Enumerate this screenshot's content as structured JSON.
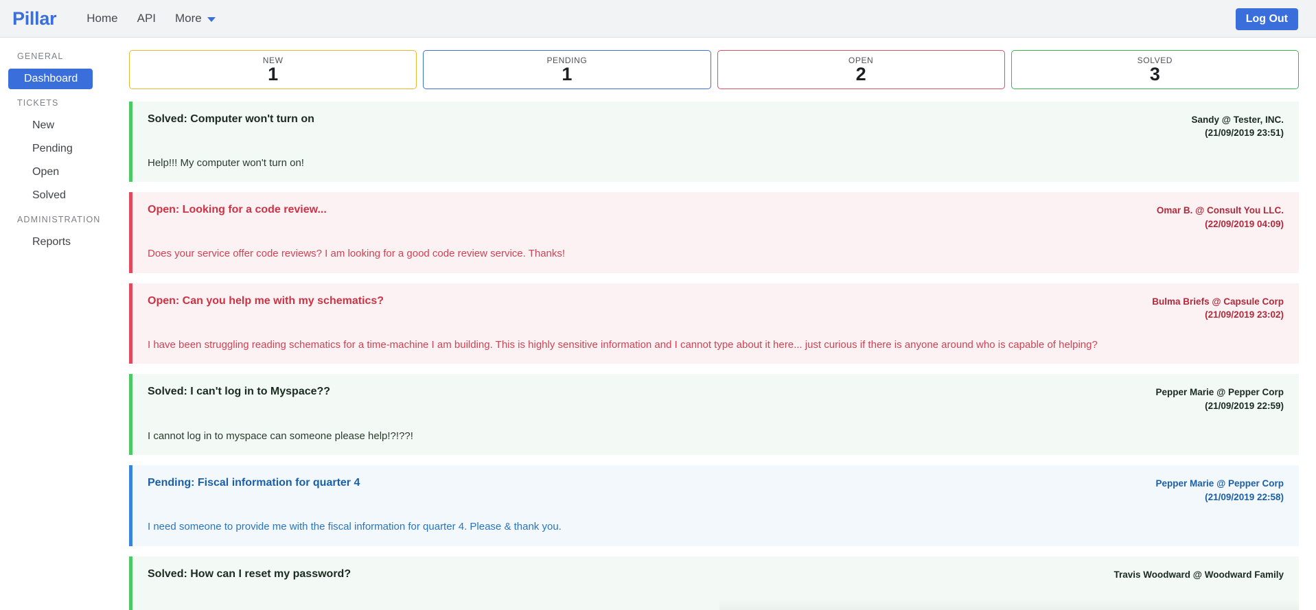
{
  "navbar": {
    "brand": "Pillar",
    "links": [
      {
        "label": "Home",
        "caret": false
      },
      {
        "label": "API",
        "caret": false
      },
      {
        "label": "More",
        "caret": true
      }
    ],
    "logout_label": "Log Out",
    "brand_color": "#3a6fdb",
    "button_color": "#3a6fdb"
  },
  "sidebar": {
    "groups": [
      {
        "heading": "GENERAL",
        "items": [
          {
            "label": "Dashboard",
            "active": true
          }
        ]
      },
      {
        "heading": "TICKETS",
        "items": [
          {
            "label": "New",
            "active": false
          },
          {
            "label": "Pending",
            "active": false
          },
          {
            "label": "Open",
            "active": false
          },
          {
            "label": "Solved",
            "active": false
          }
        ]
      },
      {
        "heading": "ADMINISTRATION",
        "items": [
          {
            "label": "Reports",
            "active": false
          }
        ]
      }
    ]
  },
  "stats": [
    {
      "label": "NEW",
      "value": "1",
      "status": "new",
      "color": "#e8b730"
    },
    {
      "label": "PENDING",
      "value": "1",
      "status": "pending",
      "color": "#3a6fdb"
    },
    {
      "label": "OPEN",
      "value": "2",
      "status": "open",
      "color": "#e04f5f"
    },
    {
      "label": "SOLVED",
      "value": "3",
      "status": "solved",
      "color": "#39b54a"
    }
  ],
  "tickets": [
    {
      "status": "solved",
      "title": "Solved: Computer won't turn on",
      "body": "Help!!! My computer won't turn on!",
      "author": "Sandy @ Tester, INC.",
      "date": "(21/09/2019 23:51)"
    },
    {
      "status": "open",
      "title": "Open: Looking for a code review...",
      "body": "Does your service offer code reviews? I am looking for a good code review service. Thanks!",
      "author": "Omar B. @ Consult You LLC.",
      "date": "(22/09/2019 04:09)"
    },
    {
      "status": "open",
      "title": "Open: Can you help me with my schematics?",
      "body": "I have been struggling reading schematics for a time-machine I am building. This is highly sensitive information and I cannot type about it here... just curious if there is anyone around who is capable of helping?",
      "author": "Bulma Briefs @ Capsule Corp",
      "date": "(21/09/2019 23:02)"
    },
    {
      "status": "solved",
      "title": "Solved: I can't log in to Myspace??",
      "body": "I cannot log in to myspace can someone please help!?!??!",
      "author": "Pepper Marie @ Pepper Corp",
      "date": "(21/09/2019 22:59)"
    },
    {
      "status": "pending",
      "title": "Pending: Fiscal information for quarter 4",
      "body": "I need someone to provide me with the fiscal information for quarter 4. Please & thank you.",
      "author": "Pepper Marie @ Pepper Corp",
      "date": "(21/09/2019 22:58)"
    },
    {
      "status": "solved",
      "title": "Solved: How can I reset my password?",
      "body": "",
      "author": "Travis Woodward @ Woodward Family",
      "date": ""
    }
  ]
}
